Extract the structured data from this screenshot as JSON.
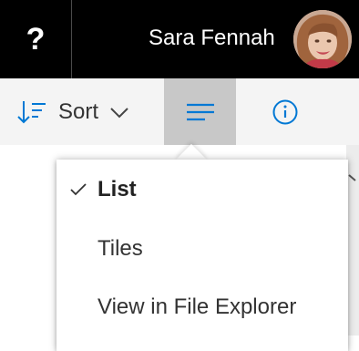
{
  "header": {
    "help_label": "?",
    "user_name": "Sara Fennah"
  },
  "toolbar": {
    "sort_label": "Sort",
    "sort_icon": "sort-icon",
    "view_icon": "list-view-icon",
    "info_icon": "info-icon"
  },
  "view_menu": {
    "items": [
      {
        "label": "List",
        "selected": true
      },
      {
        "label": "Tiles",
        "selected": false
      },
      {
        "label": "View in File Explorer",
        "selected": false
      }
    ]
  },
  "colors": {
    "accent": "#0078d4",
    "topbar": "#000000",
    "toolbar": "#f4f4f4",
    "selected_toggle": "#c8c8c8"
  }
}
